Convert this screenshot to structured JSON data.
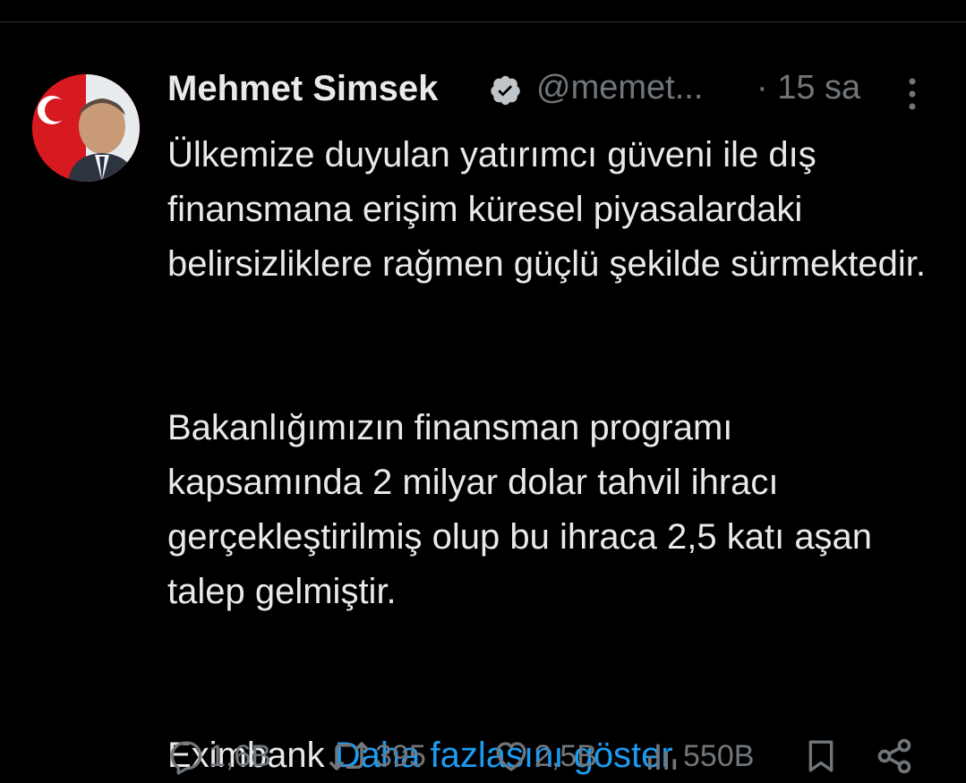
{
  "tweet": {
    "author_name": "Mehmet Simsek",
    "handle": "@memet...",
    "time": "· 15 sa",
    "paragraphs": [
      "Ülkemize duyulan yatırımcı güveni ile dış finansmana erişim küresel piyasalardaki belirsizliklere rağmen güçlü şekilde sürmektedir.",
      "Bakanlığımızın finansman programı kapsamında 2 milyar dolar tahvil ihracı gerçekleştirilmiş olup bu ihraca 2,5 katı aşan talep gelmiştir."
    ],
    "last_line_text": "Eximbank",
    "show_more": "Daha fazlasını göster"
  },
  "actions": {
    "replies": "1,6B",
    "retweets": "395",
    "likes": "2,5B",
    "views": "550B"
  },
  "colors": {
    "background": "#000000",
    "text": "#e7e9ea",
    "secondary": "#71767b",
    "link": "#1d9bf0"
  }
}
